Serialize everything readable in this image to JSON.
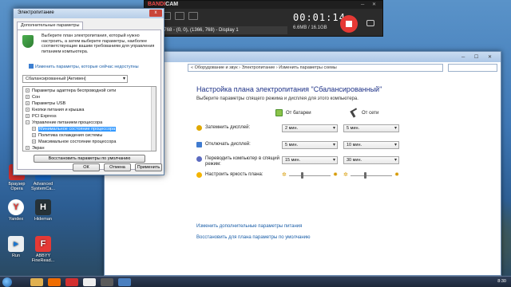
{
  "desktop": {
    "icons": [
      {
        "label": "Браузер Opera"
      },
      {
        "label": "Advanced SystemCa..."
      },
      {
        "label": "Yandex"
      },
      {
        "label": "Hideman"
      },
      {
        "label": "Run"
      },
      {
        "label": "ABBYY FineRead..."
      }
    ]
  },
  "bandicam": {
    "brand_prefix": "BANDI",
    "brand_suffix": "CAM",
    "domain": "www.BANDICAM.com",
    "timer": "00:01:14",
    "size": "6.6MB / 16.1GB",
    "coords": "1366x768 - (0, 0), (1366, 768) - Display 1"
  },
  "control_panel": {
    "breadcrumb": "« Оборудование и звук › Электропитание › Изменить параметры схемы",
    "heading": "Настройка плана электропитания \"Сбалансированный\"",
    "subheading": "Выберите параметры спящего режима и дисплея для этого компьютера.",
    "battery_label": "От батареи",
    "ac_label": "От сети",
    "rows": [
      {
        "label": "Затемнить дисплей:",
        "battery": "2 мин.",
        "ac": "5 мин."
      },
      {
        "label": "Отключать дисплей:",
        "battery": "5 мин.",
        "ac": "10 мин."
      },
      {
        "label": "Переводить компьютер в спящий\nрежим:",
        "battery": "15 мин.",
        "ac": "30 мин."
      },
      {
        "label": "Настроить яркость плана:",
        "battery": "",
        "ac": ""
      }
    ],
    "brightness": {
      "battery": 0.3,
      "ac": 0.35
    },
    "link_advanced": "Изменить дополнительные параметры питания",
    "link_restore": "Восстановить для плана параметры по умолчанию"
  },
  "dialog": {
    "title": "Электропитание",
    "close": "x",
    "tab": "Дополнительные параметры",
    "description": "Выберите план электропитания, который нужно настроить, а затем выберите параметры, наиболее соответствующие вашим требованиям для управления питанием компьютера.",
    "change_link": "Изменить параметры, которые сейчас недоступны",
    "plan": "Сбалансированный [Активен]",
    "tree": [
      {
        "label": "Параметры адаптера беспроводной сети",
        "level": 0,
        "expander": "+"
      },
      {
        "label": "Сон",
        "level": 0,
        "expander": "+"
      },
      {
        "label": "Параметры USB",
        "level": 0,
        "expander": "+"
      },
      {
        "label": "Кнопки питания и крышка",
        "level": 0,
        "expander": "+"
      },
      {
        "label": "PCI Express",
        "level": 0,
        "expander": "+"
      },
      {
        "label": "Управление питанием процессора",
        "level": 0,
        "expander": "−"
      },
      {
        "label": "Минимальное состояние процессора",
        "level": 1,
        "expander": "+",
        "selected": true
      },
      {
        "label": "Политика охлаждения системы",
        "level": 1,
        "expander": "+"
      },
      {
        "label": "Максимальное состояние процессора",
        "level": 1,
        "expander": "+"
      },
      {
        "label": "Экран",
        "level": 0,
        "expander": "+"
      }
    ],
    "restore_button": "Восстановить параметры по умолчанию",
    "ok": "ОК",
    "cancel": "Отмена",
    "apply": "Применить"
  },
  "taskbar": {
    "clock": "8:30"
  },
  "colors": {
    "link": "#1a5ea8",
    "heading": "#1e3287",
    "record_red": "#e53935",
    "selection": "#3399ff"
  }
}
